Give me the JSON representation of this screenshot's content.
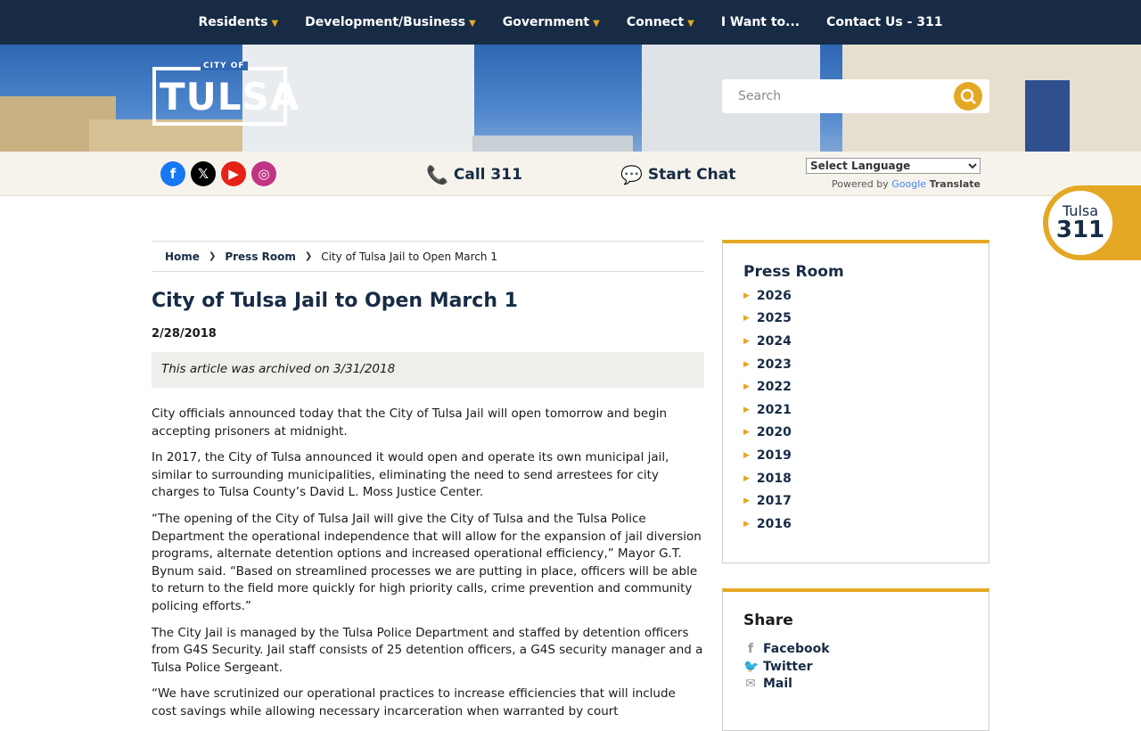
{
  "topnav": {
    "items": [
      {
        "label": "Residents",
        "dropdown": true
      },
      {
        "label": "Development/Business",
        "dropdown": true
      },
      {
        "label": "Government",
        "dropdown": true
      },
      {
        "label": "Connect",
        "dropdown": true
      },
      {
        "label": "I Want to...",
        "dropdown": false
      },
      {
        "label": "Contact Us - 311",
        "dropdown": false
      }
    ]
  },
  "logo": {
    "city_of": "CITY OF",
    "name": "TULSA"
  },
  "search": {
    "placeholder": "Search",
    "icon": "search-icon"
  },
  "utility": {
    "social": [
      {
        "name": "facebook-icon",
        "glyph": "f",
        "color": "#1877f2"
      },
      {
        "name": "x-icon",
        "glyph": "𝕏",
        "color": "#000000"
      },
      {
        "name": "youtube-icon",
        "glyph": "▶",
        "color": "#e62117"
      },
      {
        "name": "instagram-icon",
        "glyph": "◎",
        "color": "#c13584"
      }
    ],
    "call_label": "Call 311",
    "chat_label": "Start Chat",
    "language_select": "Select Language",
    "powered_by": "Powered by",
    "google": "Google",
    "translate": "Translate"
  },
  "badge": {
    "line1": "Tulsa",
    "line2": "311"
  },
  "breadcrumb": {
    "home": "Home",
    "section": "Press Room",
    "current": "City of Tulsa Jail to Open March 1"
  },
  "article": {
    "title": "City of Tulsa Jail to Open March 1",
    "date": "2/28/2018",
    "archived": "This article was archived on 3/31/2018",
    "paragraphs": [
      "City officials announced today that the City of Tulsa Jail will open tomorrow and begin accepting prisoners at midnight.",
      "In 2017, the City of Tulsa announced it would open and operate its own municipal jail, similar to surrounding municipalities, eliminating the need to send arrestees for city charges to Tulsa County’s David L. Moss Justice Center.",
      "“The opening of the City of Tulsa Jail will give the City of Tulsa and the Tulsa Police Department the operational independence that will allow for the expansion of jail diversion programs, alternate detention options and increased operational efficiency,” Mayor G.T. Bynum said. “Based on streamlined processes we are putting in place, officers will be able to return to the field more quickly for high priority calls, crime prevention and community policing efforts.”",
      "The City Jail is managed by the Tulsa Police Department and staffed by detention officers from G4S Security. Jail staff consists of 25 detention officers, a G4S security manager and a Tulsa Police Sergeant.",
      "“We have scrutinized our operational practices to increase efficiencies that will include cost savings while allowing necessary incarceration when warranted by court"
    ]
  },
  "press_room": {
    "heading": "Press Room",
    "years": [
      "2026",
      "2025",
      "2024",
      "2023",
      "2022",
      "2021",
      "2020",
      "2019",
      "2018",
      "2017",
      "2016"
    ]
  },
  "share": {
    "heading": "Share",
    "items": [
      {
        "label": "Facebook",
        "icon": "facebook-icon",
        "glyph": "f"
      },
      {
        "label": "Twitter",
        "icon": "twitter-icon",
        "glyph": "🐦"
      },
      {
        "label": "Mail",
        "icon": "mail-icon",
        "glyph": "✉"
      }
    ]
  },
  "colors": {
    "navy": "#172b45",
    "gold": "#e4a824",
    "utility_bg": "#f6f3ec"
  }
}
